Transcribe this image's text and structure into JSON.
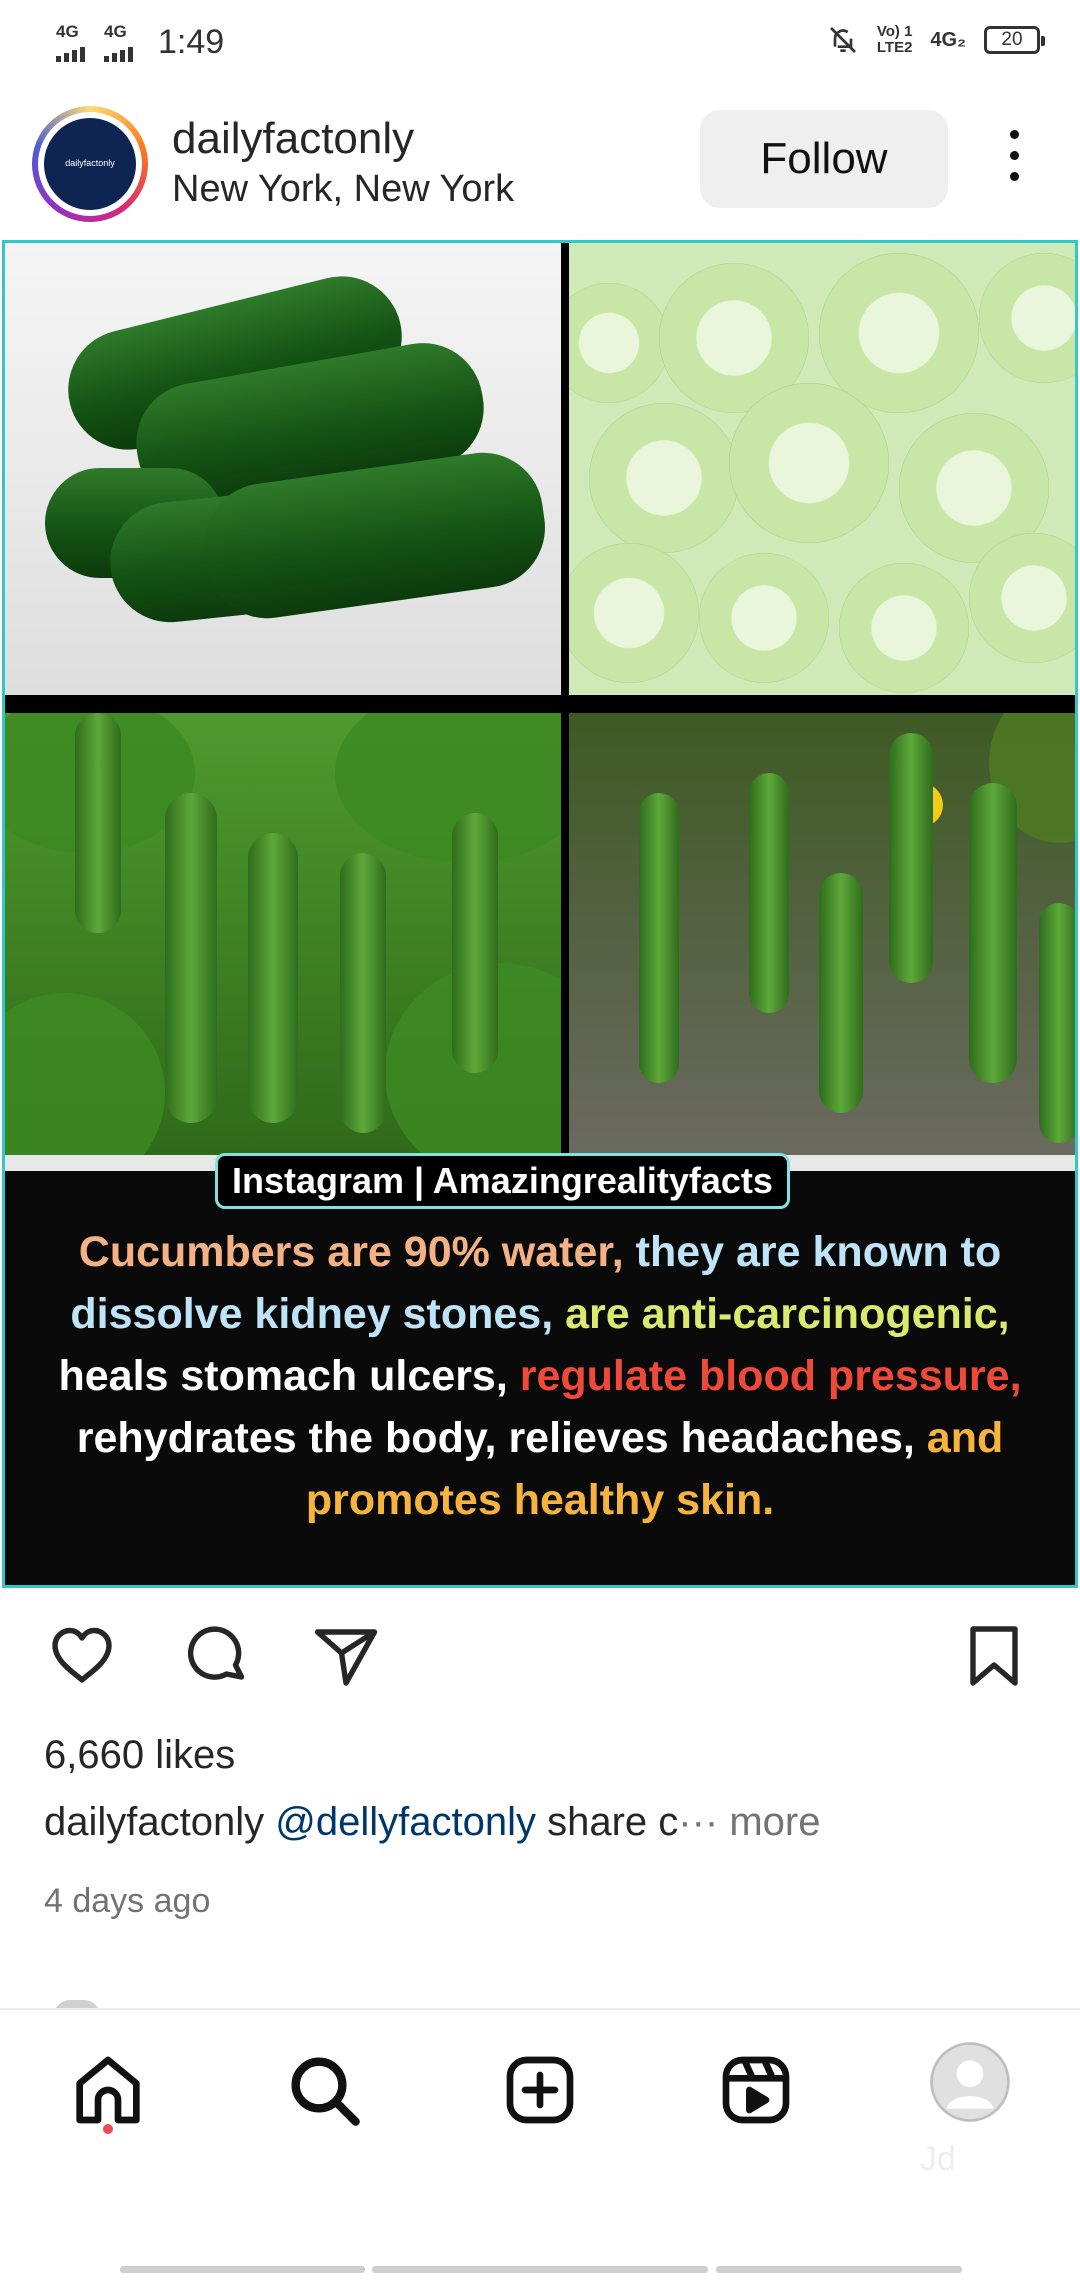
{
  "status_bar": {
    "network_1": "4G",
    "network_2": "4G",
    "time": "1:49",
    "volte_top": "Vo) 1",
    "volte_bottom": "LTE2",
    "network_3": "4G₂",
    "battery": "20"
  },
  "post": {
    "username": "dailyfactonly",
    "location": "New York, New York",
    "follow_label": "Follow",
    "avatar_text": "dailyfactonly",
    "image": {
      "brand_tag": "Instagram | Amazingrealityfacts",
      "fact_segments": [
        "Cucumbers are 90% water,",
        " they are known to dissolve kidney stones,",
        " are anti-carcinogenic,",
        " heals stomach ulcers,",
        " regulate blood pressure,",
        " rehydrates the body, relieves headaches,",
        " and promotes healthy skin."
      ]
    },
    "likes": "6,660 likes",
    "caption_user": "dailyfactonly",
    "caption_mention": "@dellyfactonly",
    "caption_text": " share c",
    "caption_ellipsis": "··· ",
    "caption_more": "more",
    "time_ago": "4 days ago"
  },
  "icons": {
    "like": "heart-icon",
    "comment": "comment-icon",
    "share": "paper-plane-icon",
    "save": "bookmark-icon",
    "home": "home-icon",
    "search": "search-icon",
    "create": "plus-square-icon",
    "reels": "reels-icon",
    "profile": "profile-avatar"
  },
  "nav": {
    "watermark": "Jd"
  },
  "colors": {
    "link": "#00376b",
    "secondary_text": "#737373",
    "image_border": "#33c7c7",
    "notification_dot": "#ed4956"
  }
}
